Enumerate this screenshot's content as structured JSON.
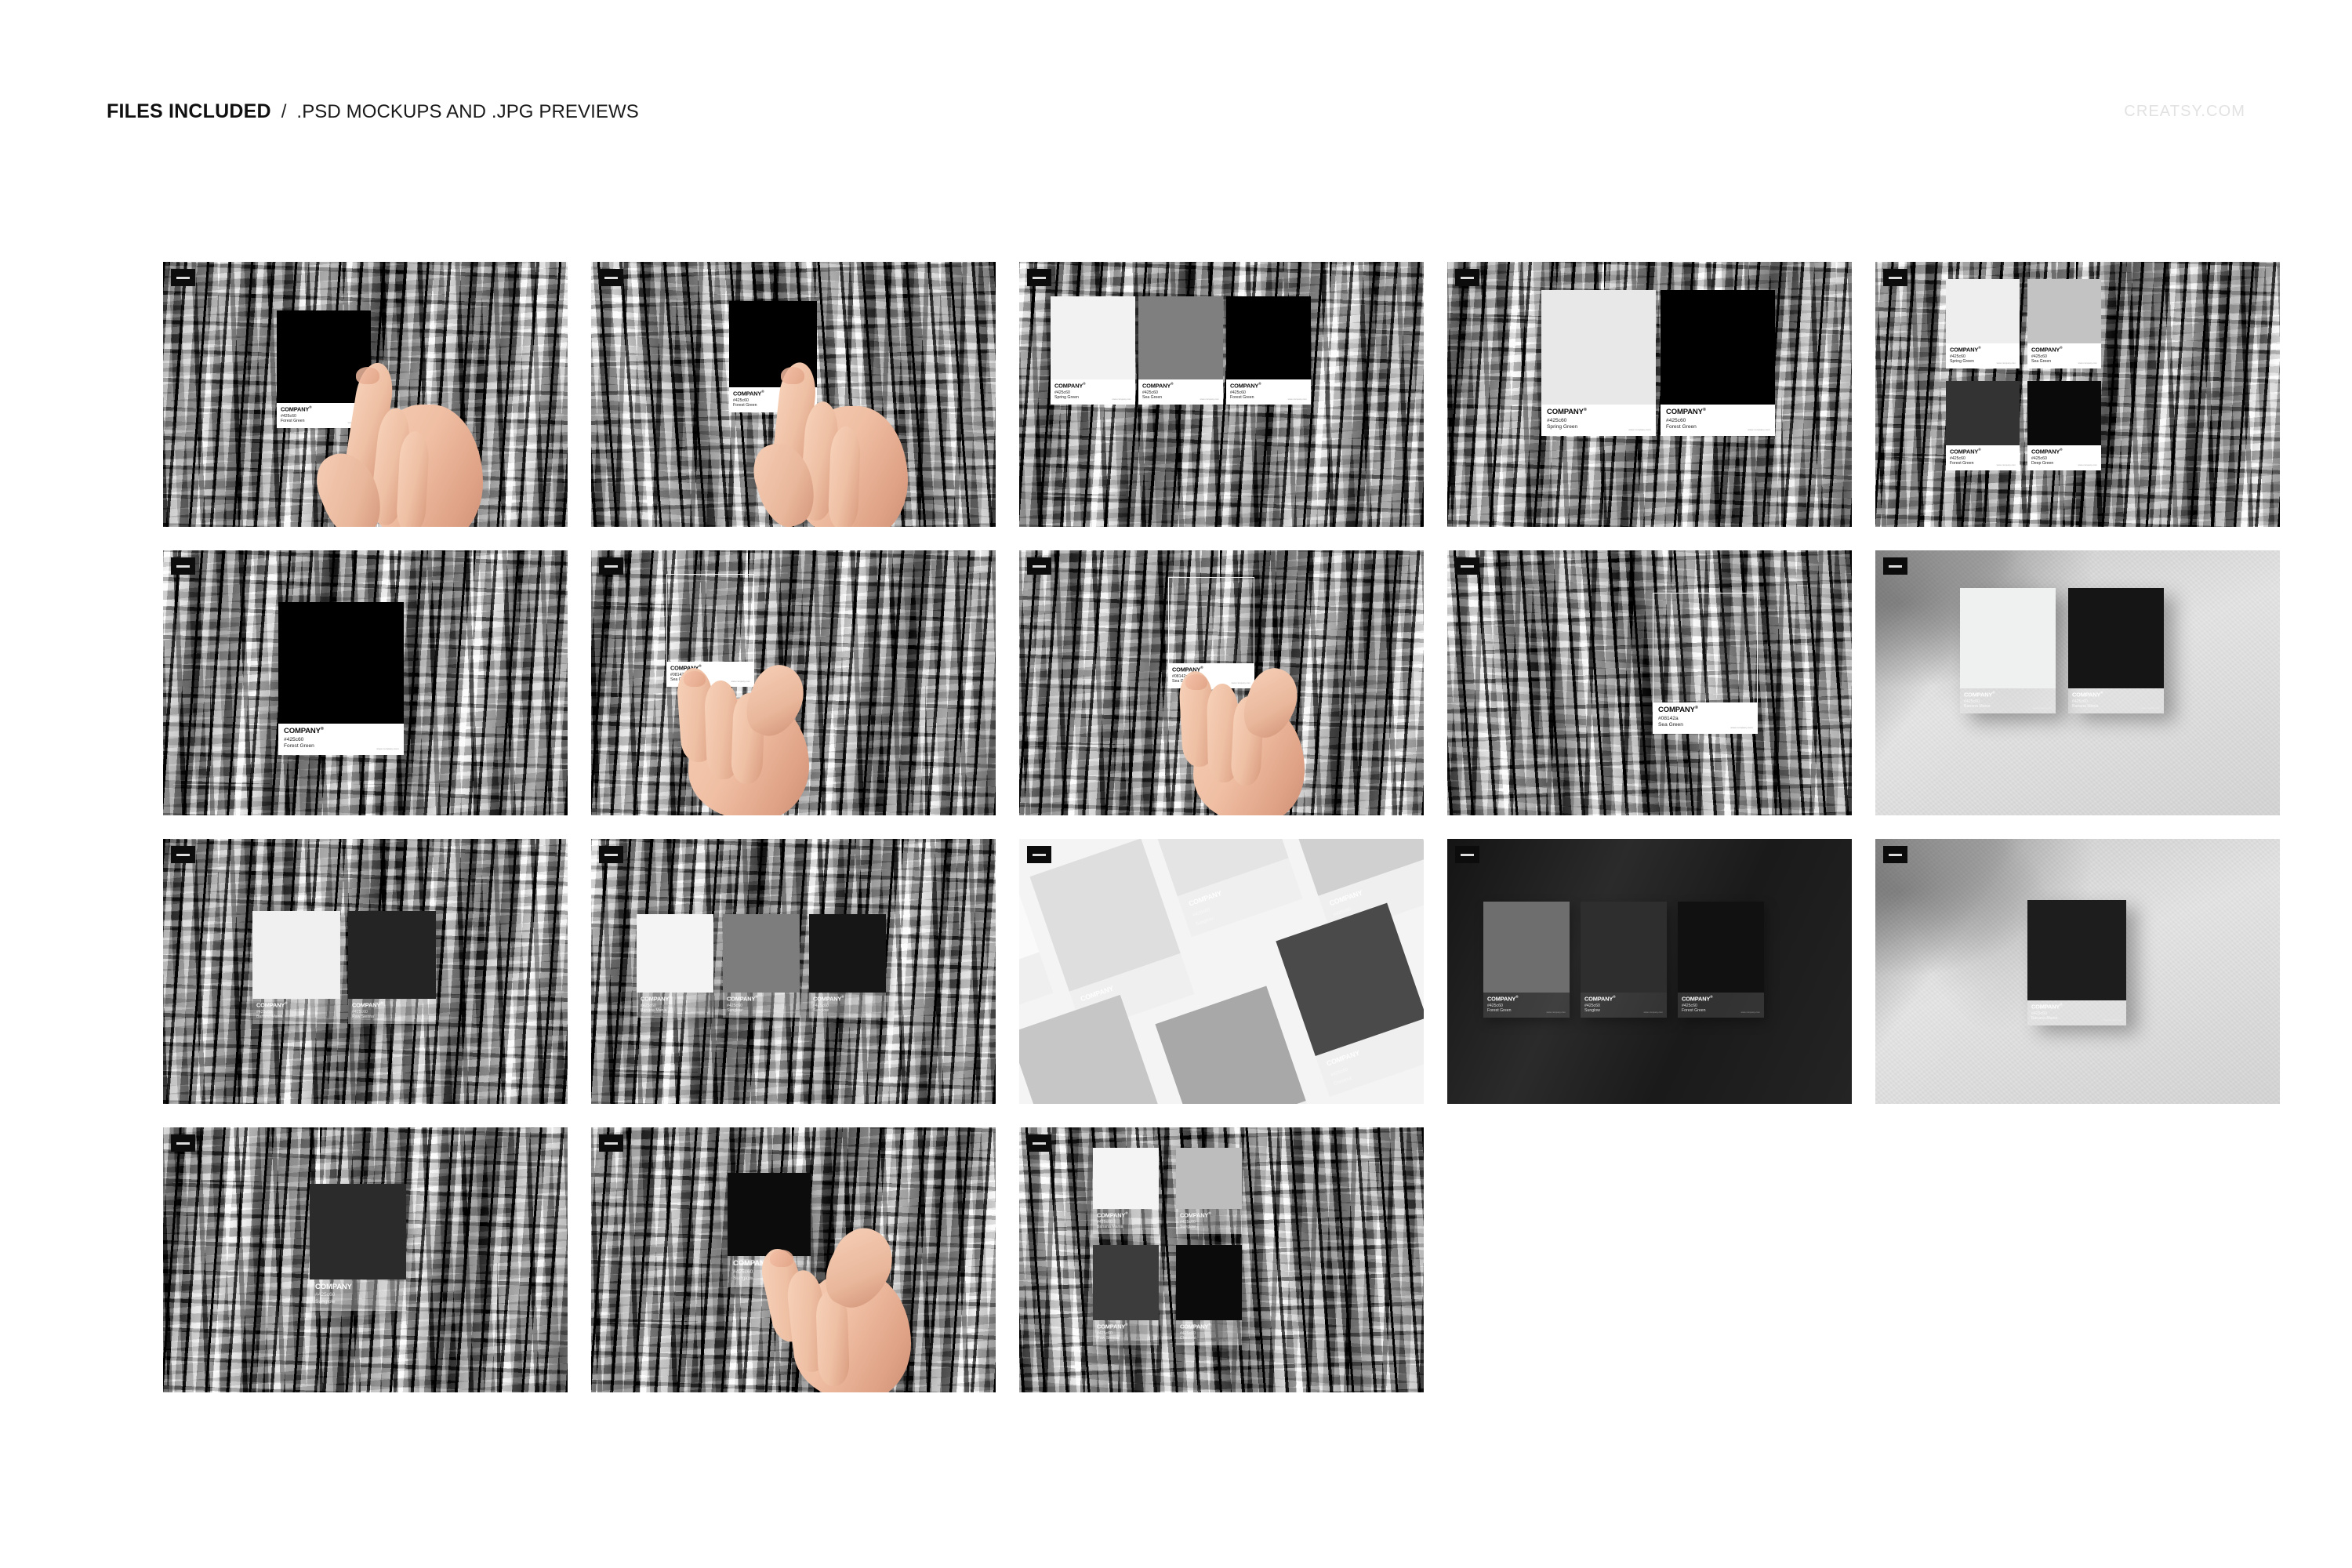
{
  "header": {
    "title_strong": "FILES INCLUDED",
    "separator": "/",
    "title_rest": ".PSD MOCKUPS AND .JPG PREVIEWS",
    "watermark": "CREATSY.COM"
  },
  "card_defaults": {
    "company": "COMPANY",
    "registered_mark": "®",
    "url": "www.company.com"
  },
  "palette": {
    "hex_primary": "#425c60",
    "hex_alt": "#08142a",
    "chip_spring_green": "#f2f2f2",
    "chip_sea_green": "#7f7f7f",
    "chip_forest_green": "#000000",
    "chip_deep_green": "#0a0a0a",
    "chip_sea_green_light": "#c3c3c3",
    "chip_forest_green_dark": "#333333",
    "chip_sunglow": "#262626",
    "chip_raw_sienna": "#242424",
    "chip_banana_mania": "#f2f2f2",
    "chip_chestnut": "#111111",
    "label_white": "#ffffff",
    "text_dark": "#0d0d0d",
    "badge_bg": "#0c0c0c",
    "page_bg": "#ffffff",
    "watermark_color": "#e2e2e2"
  },
  "thumbnails": [
    {
      "id": "t1",
      "row": 0,
      "col": 0,
      "scene": "bark-hand-single",
      "cards": [
        {
          "hex": "#425c60",
          "name": "Forest Green",
          "chip": "#000000",
          "company": "COMPANY"
        }
      ]
    },
    {
      "id": "t2",
      "row": 0,
      "col": 1,
      "scene": "bark-hand-single-pinch",
      "cards": [
        {
          "hex": "#425c60",
          "name": "Forest Green",
          "chip": "#000000",
          "company": "COMPANY"
        }
      ]
    },
    {
      "id": "t3",
      "row": 0,
      "col": 2,
      "scene": "bark-three-cards",
      "cards": [
        {
          "hex": "#425c60",
          "name": "Spring Green",
          "chip": "#f2f2f2",
          "company": "COMPANY"
        },
        {
          "hex": "#425c60",
          "name": "Sea Green",
          "chip": "#7f7f7f",
          "company": "COMPANY"
        },
        {
          "hex": "#425c60",
          "name": "Forest Green",
          "chip": "#000000",
          "company": "COMPANY"
        }
      ]
    },
    {
      "id": "t4",
      "row": 0,
      "col": 3,
      "scene": "bark-two-cards",
      "cards": [
        {
          "hex": "#425c60",
          "name": "Spring Green",
          "chip": "#e8e8e8",
          "company": "COMPANY"
        },
        {
          "hex": "#425c60",
          "name": "Forest Green",
          "chip": "#000000",
          "company": "COMPANY"
        }
      ]
    },
    {
      "id": "t5",
      "row": 0,
      "col": 4,
      "scene": "bark-four-cards",
      "cards": [
        {
          "hex": "#425c60",
          "name": "Spring Green",
          "chip": "#eeeeee",
          "company": "COMPANY"
        },
        {
          "hex": "#425c60",
          "name": "Sea Green",
          "chip": "#c3c3c3",
          "company": "COMPANY"
        },
        {
          "hex": "#425c60",
          "name": "Forest Green",
          "chip": "#333333",
          "company": "COMPANY"
        },
        {
          "hex": "#425c60",
          "name": "Deep Green",
          "chip": "#0a0a0a",
          "company": "COMPANY"
        }
      ]
    },
    {
      "id": "t6",
      "row": 1,
      "col": 0,
      "scene": "bark-single-centered",
      "cards": [
        {
          "hex": "#425c60",
          "name": "Forest Green",
          "chip": "#000000",
          "company": "COMPANY"
        }
      ]
    },
    {
      "id": "t7",
      "row": 1,
      "col": 1,
      "scene": "bark-hand-transparent",
      "cards": [
        {
          "hex": "#08142a",
          "name": "Sea Green",
          "chip": "transparent",
          "company": "COMPANY"
        }
      ]
    },
    {
      "id": "t8",
      "row": 1,
      "col": 2,
      "scene": "bark-hand-transparent-pinch",
      "cards": [
        {
          "hex": "#08142a",
          "name": "Sea Green",
          "chip": "transparent",
          "company": "COMPANY"
        }
      ]
    },
    {
      "id": "t9",
      "row": 1,
      "col": 3,
      "scene": "bark-transparent-single",
      "cards": [
        {
          "hex": "#08142a",
          "name": "Sea Green",
          "chip": "transparent",
          "company": "COMPANY"
        }
      ]
    },
    {
      "id": "t10",
      "row": 1,
      "col": 4,
      "scene": "concrete-two-cards",
      "cards": [
        {
          "hex": "#425c60",
          "name": "Banana Mania",
          "chip": "#eff0f0",
          "company": "COMPANY"
        },
        {
          "hex": "#425c60",
          "name": "Banana Mania",
          "chip": "#151515",
          "company": "COMPANY"
        }
      ]
    },
    {
      "id": "t11",
      "row": 2,
      "col": 0,
      "scene": "bark-two-glasslabel",
      "cards": [
        {
          "hex": "#425c60",
          "name": "Banana Mania",
          "chip": "#f0f0f0",
          "company": "COMPANY"
        },
        {
          "hex": "#425c60",
          "name": "Raw Sienna",
          "chip": "#242424",
          "company": "COMPANY"
        }
      ]
    },
    {
      "id": "t12",
      "row": 2,
      "col": 1,
      "scene": "bark-three-glasslabel",
      "cards": [
        {
          "hex": "#425c60",
          "name": "Banana Mania",
          "chip": "#f4f4f4",
          "company": "COMPANY"
        },
        {
          "hex": "#425c60",
          "name": "Sunglow",
          "chip": "#7d7d7d",
          "company": "COMPANY"
        },
        {
          "hex": "#425c60",
          "name": "Sunglow",
          "chip": "#161616",
          "company": "COMPANY"
        }
      ]
    },
    {
      "id": "t13",
      "row": 2,
      "col": 2,
      "scene": "tilted-mosaic",
      "cards": [
        {
          "hex": "#425c60",
          "name": "Banana Mania",
          "chip": "#fafafa",
          "company": "COMPANY"
        },
        {
          "hex": "#425c60",
          "name": "Banana Mania",
          "chip": "#dedede",
          "company": "COMPANY"
        },
        {
          "hex": "#425c60",
          "name": "Sunglow",
          "chip": "#cfcfcf",
          "company": "COMPANY"
        },
        {
          "hex": "#425c60",
          "name": "Sunglow",
          "chip": "#d8d8d8",
          "company": "COMPANY"
        },
        {
          "hex": "#425c60",
          "name": "Raw Sienna",
          "chip": "#a8a8a8",
          "company": "COMPANY"
        },
        {
          "hex": "#425c60",
          "name": "Chestnut",
          "chip": "#4a4a4a",
          "company": "COMPANY"
        }
      ]
    },
    {
      "id": "t14",
      "row": 2,
      "col": 3,
      "scene": "dark-three-cards",
      "cards": [
        {
          "hex": "#425c60",
          "name": "Forest Green",
          "chip": "#6e6e6e",
          "company": "COMPANY"
        },
        {
          "hex": "#425c60",
          "name": "Sunglow",
          "chip": "#2e2e2e",
          "company": "COMPANY"
        },
        {
          "hex": "#425c60",
          "name": "Forest Green",
          "chip": "#111111",
          "company": "COMPANY"
        }
      ]
    },
    {
      "id": "t15",
      "row": 2,
      "col": 4,
      "scene": "concrete-single-card",
      "cards": [
        {
          "hex": "#425c60",
          "name": "Banana Mania",
          "chip": "#1d1d1d",
          "company": "COMPANY"
        }
      ]
    },
    {
      "id": "t16",
      "row": 3,
      "col": 0,
      "scene": "bark-single-glasslabel",
      "cards": [
        {
          "hex": "#425c60",
          "name": "Sunglow",
          "chip": "#2b2b2b",
          "company": "COMPANY"
        }
      ]
    },
    {
      "id": "t17",
      "row": 3,
      "col": 1,
      "scene": "bark-hand-glasslabel",
      "cards": [
        {
          "hex": "#425c60",
          "name": "Sunglow",
          "chip": "#0c0c0c",
          "company": "COMPANY"
        }
      ]
    },
    {
      "id": "t18",
      "row": 3,
      "col": 2,
      "scene": "bark-four-glasslabel",
      "cards": [
        {
          "hex": "#425c60",
          "name": "Banana Mania",
          "chip": "#f4f4f4",
          "company": "COMPANY"
        },
        {
          "hex": "#425c60",
          "name": "Sunglow",
          "chip": "#bdbdbd",
          "company": "COMPANY"
        },
        {
          "hex": "#425c60",
          "name": "Raw Sienna",
          "chip": "#3c3c3c",
          "company": "COMPANY"
        },
        {
          "hex": "#425c60",
          "name": "Chestnut",
          "chip": "#0b0b0b",
          "company": "COMPANY"
        }
      ]
    }
  ]
}
